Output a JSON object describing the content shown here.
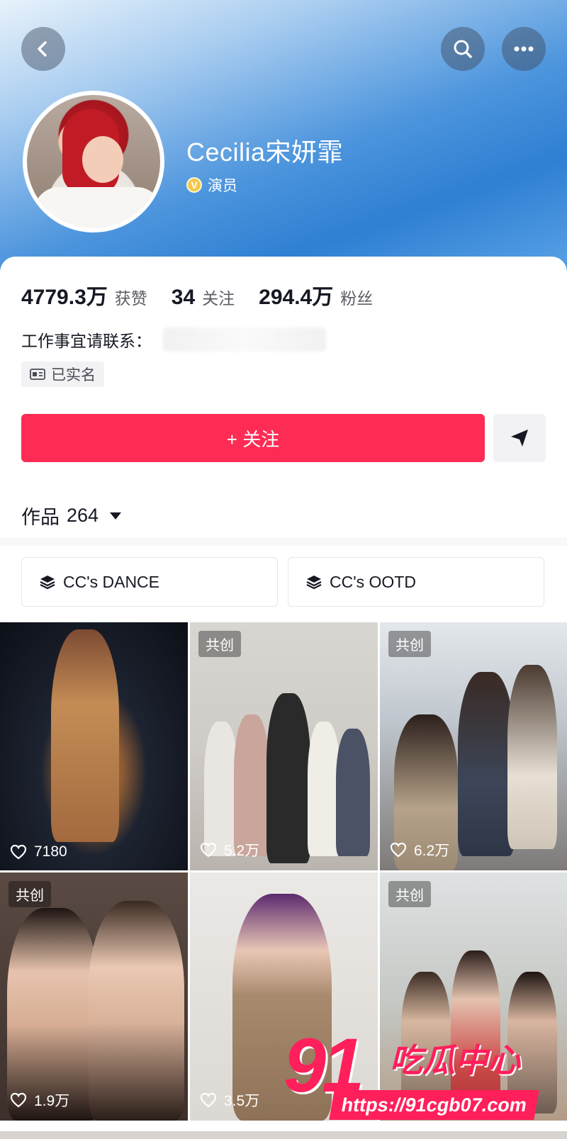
{
  "header": {
    "icons": {
      "back": "back-chevron-icon",
      "search": "search-icon",
      "more": "more-dots-icon"
    }
  },
  "profile": {
    "name": "Cecilia宋妍霏",
    "verified_label": "演员",
    "verified_icon": "verified-v-icon"
  },
  "stats": [
    {
      "value": "4779.3万",
      "label": "获赞"
    },
    {
      "value": "34",
      "label": "关注"
    },
    {
      "value": "294.4万",
      "label": "粉丝"
    }
  ],
  "contact": {
    "label": "工作事宜请联系："
  },
  "realname": {
    "label": "已实名",
    "icon": "id-card-icon"
  },
  "actions": {
    "follow_label": "+ 关注",
    "share_icon": "send-icon"
  },
  "works": {
    "label": "作品",
    "count": "264"
  },
  "collections": [
    {
      "label": "CC's DANCE",
      "icon": "stack-icon"
    },
    {
      "label": "CC's OOTD",
      "icon": "stack-icon"
    }
  ],
  "videos": [
    {
      "badge": "",
      "likes": "7180"
    },
    {
      "badge": "共创",
      "likes": "5.2万"
    },
    {
      "badge": "共创",
      "likes": "6.2万"
    },
    {
      "badge": "共创",
      "likes": "1.9万"
    },
    {
      "badge": "",
      "likes": "3.5万"
    },
    {
      "badge": "共创",
      "likes": ""
    }
  ],
  "watermark": {
    "number": "91",
    "text": "吃瓜中心",
    "url": "https://91cgb07.com"
  },
  "colors": {
    "accent": "#fe2c55",
    "watermark": "#ff1f5a"
  }
}
